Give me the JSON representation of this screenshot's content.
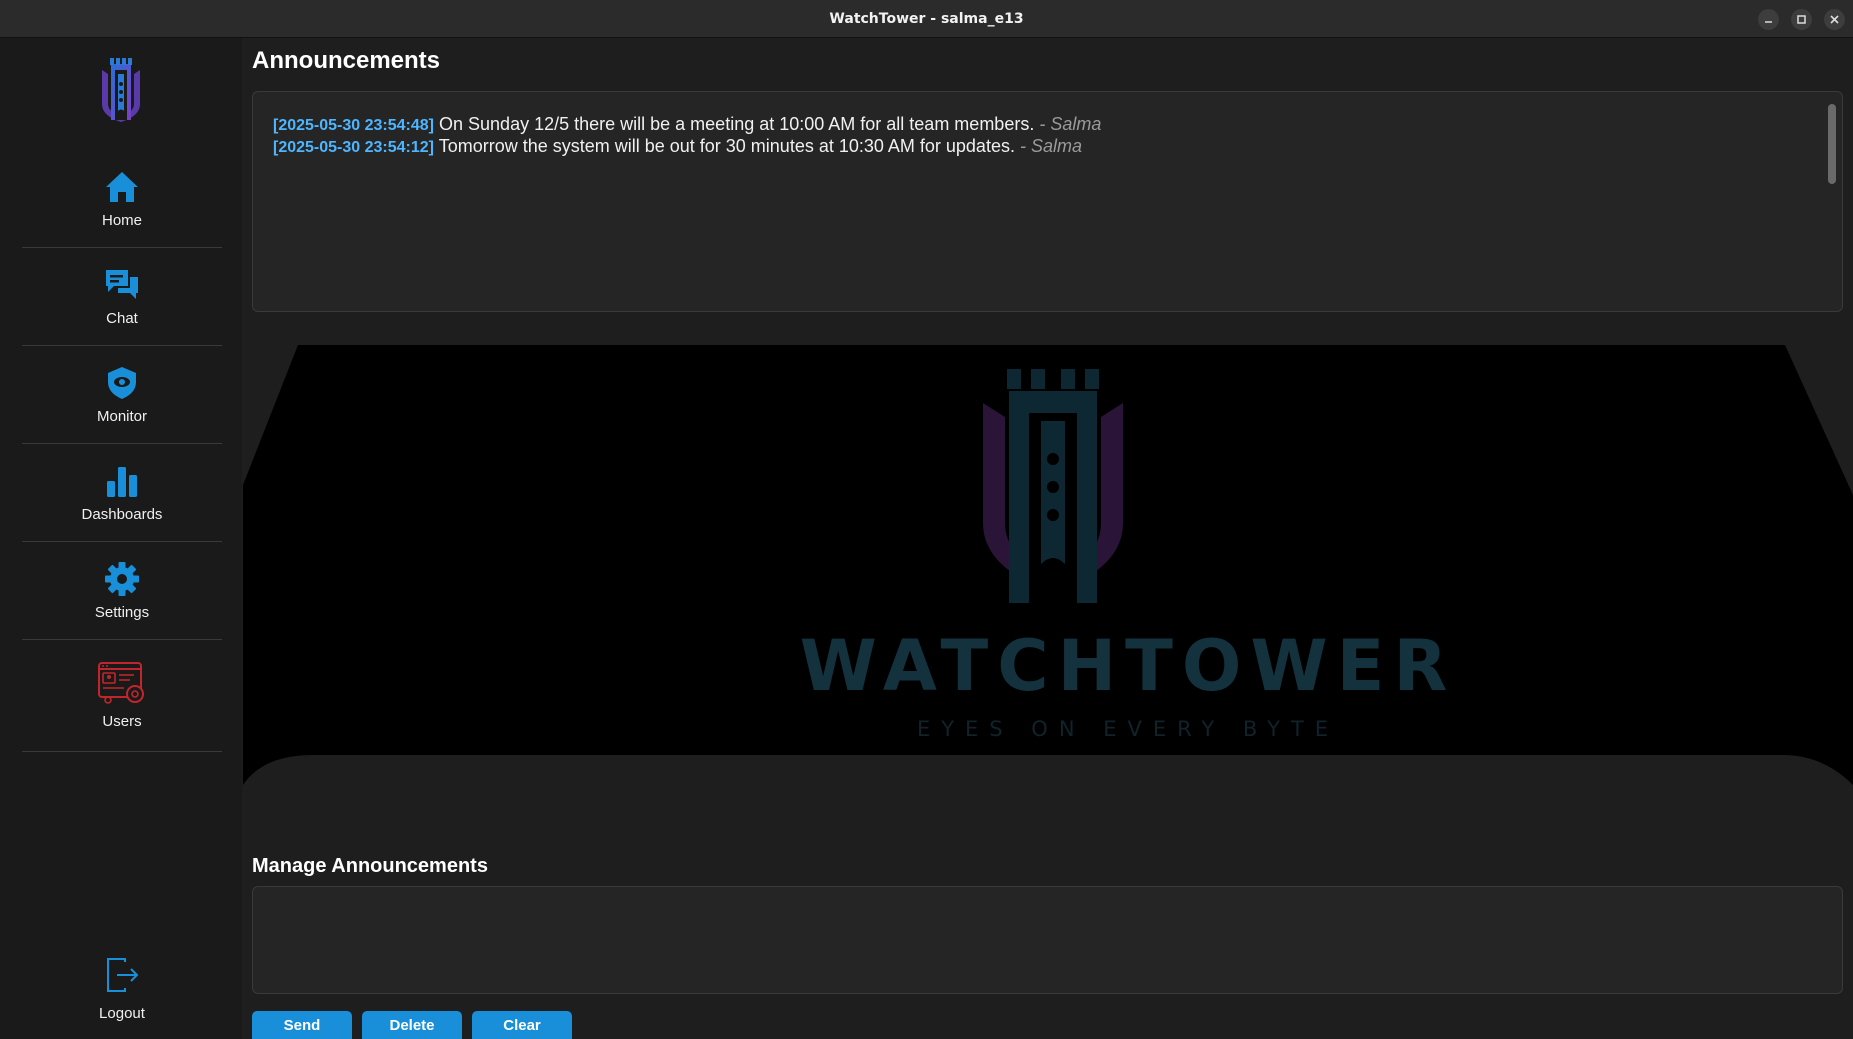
{
  "window": {
    "title": "WatchTower - salma_e13"
  },
  "sidebar": {
    "items": [
      {
        "label": "Home",
        "icon": "home-icon"
      },
      {
        "label": "Chat",
        "icon": "chat-icon"
      },
      {
        "label": "Monitor",
        "icon": "shield-eye-icon"
      },
      {
        "label": "Dashboards",
        "icon": "bar-chart-icon"
      },
      {
        "label": "Settings",
        "icon": "gear-icon"
      },
      {
        "label": "Users",
        "icon": "user-management-icon"
      }
    ],
    "logout_label": "Logout"
  },
  "announcements": {
    "heading": "Announcements",
    "items": [
      {
        "timestamp": "[2025-05-30 23:54:48]",
        "text": "On Sunday 12/5 there will be a meeting at 10:00 AM for all team members.",
        "author": "- Salma"
      },
      {
        "timestamp": "[2025-05-30 23:54:12]",
        "text": "Tomorrow the system will be out for 30 minutes at 10:30 AM for updates.",
        "author": "- Salma"
      }
    ]
  },
  "banner": {
    "brand_name": "WATCHTOWER",
    "tagline": "EYES ON EVERY BYTE"
  },
  "manage": {
    "heading": "Manage Announcements",
    "input_value": "",
    "send_label": "Send",
    "delete_label": "Delete",
    "clear_label": "Clear"
  },
  "colors": {
    "accent": "#1a8fd9",
    "timestamp": "#4db6ff",
    "background": "#1e1e1e",
    "sidebar": "#1a1a1a"
  }
}
